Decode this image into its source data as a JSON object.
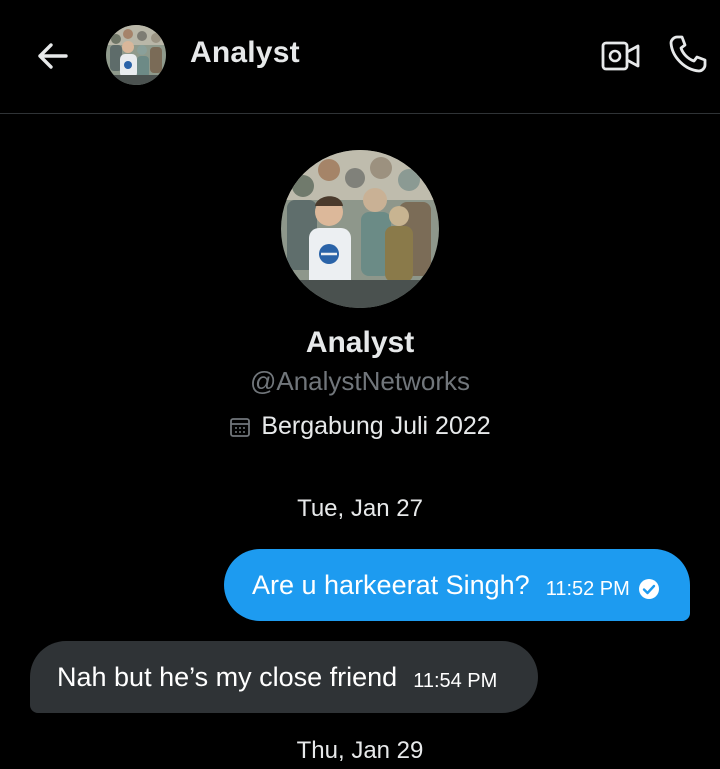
{
  "header": {
    "title": "Analyst",
    "back_icon": "arrow-left-icon",
    "video_icon": "video-call-icon",
    "call_icon": "phone-icon"
  },
  "profile": {
    "name": "Analyst",
    "handle": "@AnalystNetworks",
    "joined": "Bergabung Juli 2022",
    "joined_icon": "calendar-icon"
  },
  "conversation": {
    "date_1": "Tue, Jan 27",
    "date_2": "Thu, Jan 29",
    "messages": [
      {
        "direction": "sent",
        "text": "Are u harkeerat Singh?",
        "time": "11:52 PM",
        "status": "read"
      },
      {
        "direction": "received",
        "text": "Nah but he’s my close friend",
        "time": "11:54 PM"
      }
    ]
  },
  "colors": {
    "background": "#000000",
    "sent_bubble": "#1d9bf0",
    "received_bubble": "#2f3336",
    "secondary_text": "#71767b",
    "divider": "#2f3336"
  }
}
